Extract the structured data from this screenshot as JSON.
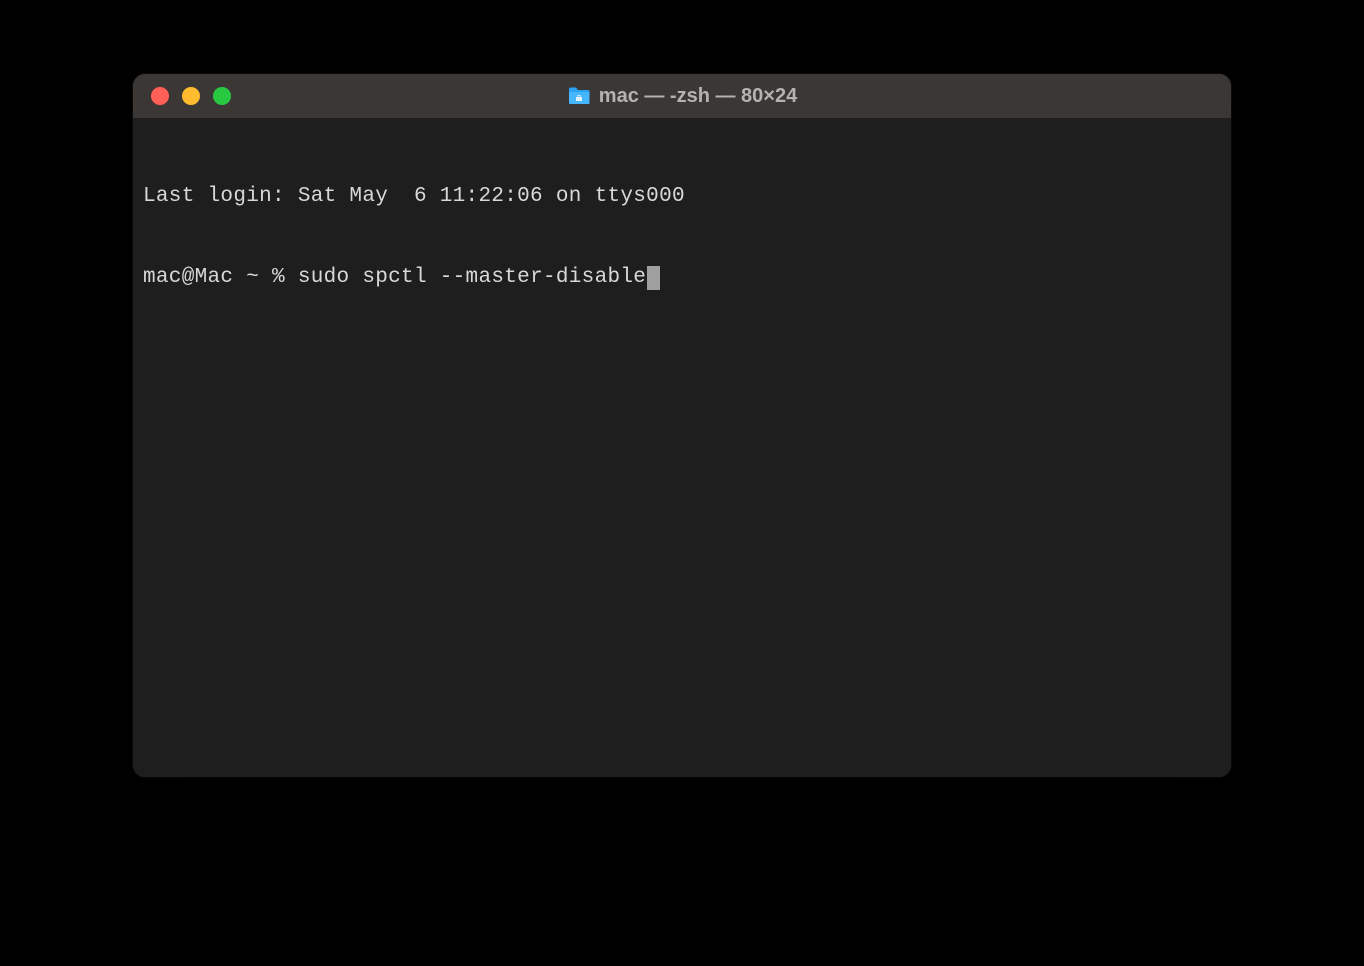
{
  "window": {
    "title": "mac — -zsh — 80×24"
  },
  "terminal": {
    "lastLoginLine": "Last login: Sat May  6 11:22:06 on ttys000",
    "prompt": "mac@Mac ~ % ",
    "command": "sudo spctl --master-disable"
  }
}
